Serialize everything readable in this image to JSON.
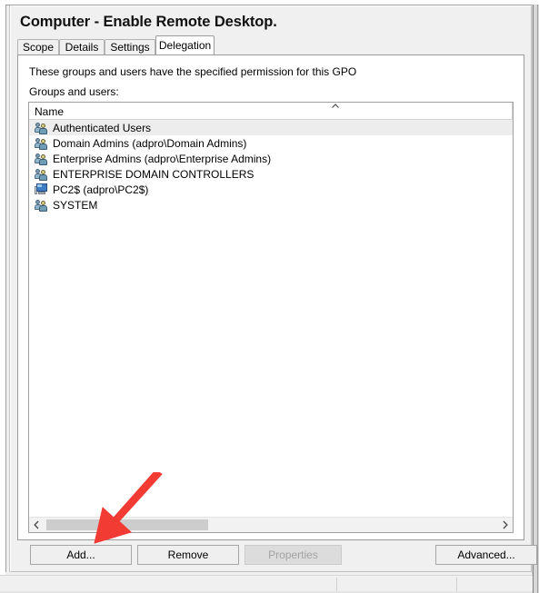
{
  "window": {
    "title": "Computer - Enable Remote Desktop."
  },
  "tabs": [
    {
      "label": "Scope",
      "active": false
    },
    {
      "label": "Details",
      "active": false
    },
    {
      "label": "Settings",
      "active": false
    },
    {
      "label": "Delegation",
      "active": true
    }
  ],
  "page": {
    "description": "These groups and users have the specified permission for this GPO",
    "groups_label": "Groups and users:"
  },
  "list": {
    "column_header": "Name",
    "sort_indicator_icon": "chevron-up-icon",
    "rows": [
      {
        "name": "Authenticated Users",
        "icon": "group-icon",
        "selected": true
      },
      {
        "name": "Domain Admins (adpro\\Domain Admins)",
        "icon": "group-icon",
        "selected": false
      },
      {
        "name": "Enterprise Admins (adpro\\Enterprise Admins)",
        "icon": "group-icon",
        "selected": false
      },
      {
        "name": "ENTERPRISE DOMAIN CONTROLLERS",
        "icon": "group-icon",
        "selected": false
      },
      {
        "name": "PC2$ (adpro\\PC2$)",
        "icon": "computer-icon",
        "selected": false
      },
      {
        "name": "SYSTEM",
        "icon": "group-icon",
        "selected": false
      }
    ],
    "scrollbar": {
      "left_arrow_icon": "chevron-left-icon",
      "right_arrow_icon": "chevron-right-icon"
    }
  },
  "buttons": {
    "add": "Add...",
    "remove": "Remove",
    "properties": "Properties",
    "advanced": "Advanced..."
  },
  "annotation": {
    "type": "arrow",
    "points_to": "add-button",
    "color": "#f23b33"
  },
  "colors": {
    "panel_bg": "#f0f0f0",
    "page_bg": "#ffffff",
    "selection": "#ededed",
    "border": "#9c9c9c",
    "disabled_text": "#a2a2a2",
    "annotation_red": "#f23b33"
  }
}
